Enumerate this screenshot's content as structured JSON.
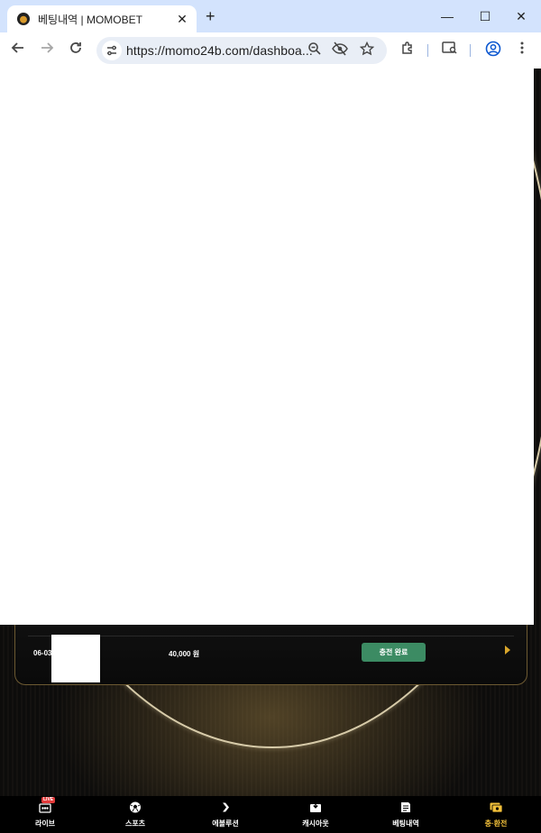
{
  "browser": {
    "tab_title": "베팅내역 | MOMOBET",
    "tab_close": "✕",
    "new_tab": "+",
    "url": "https://momo24b.com/dashboa...",
    "window_controls": {
      "minimize": "—",
      "maximize": "☐",
      "close": "✕"
    }
  },
  "betting_row": {
    "date": "06-03",
    "amount": "40,000 원",
    "status": "충전 완료"
  },
  "bottom_nav": {
    "items": [
      {
        "label": "라이브",
        "icon": "live-tv-icon",
        "badge": "LIVE"
      },
      {
        "label": "스포츠",
        "icon": "soccer-ball-icon"
      },
      {
        "label": "에볼루션",
        "icon": "evolution-logo-icon"
      },
      {
        "label": "캐시아웃",
        "icon": "cashout-icon"
      },
      {
        "label": "베팅내역",
        "icon": "betting-history-icon"
      },
      {
        "label": "충·환전",
        "icon": "deposit-withdraw-icon",
        "active": true
      }
    ]
  },
  "colors": {
    "accent_gold": "#f3c13a",
    "status_green": "#3c8b63",
    "browser_chrome": "#d3e3fd"
  }
}
